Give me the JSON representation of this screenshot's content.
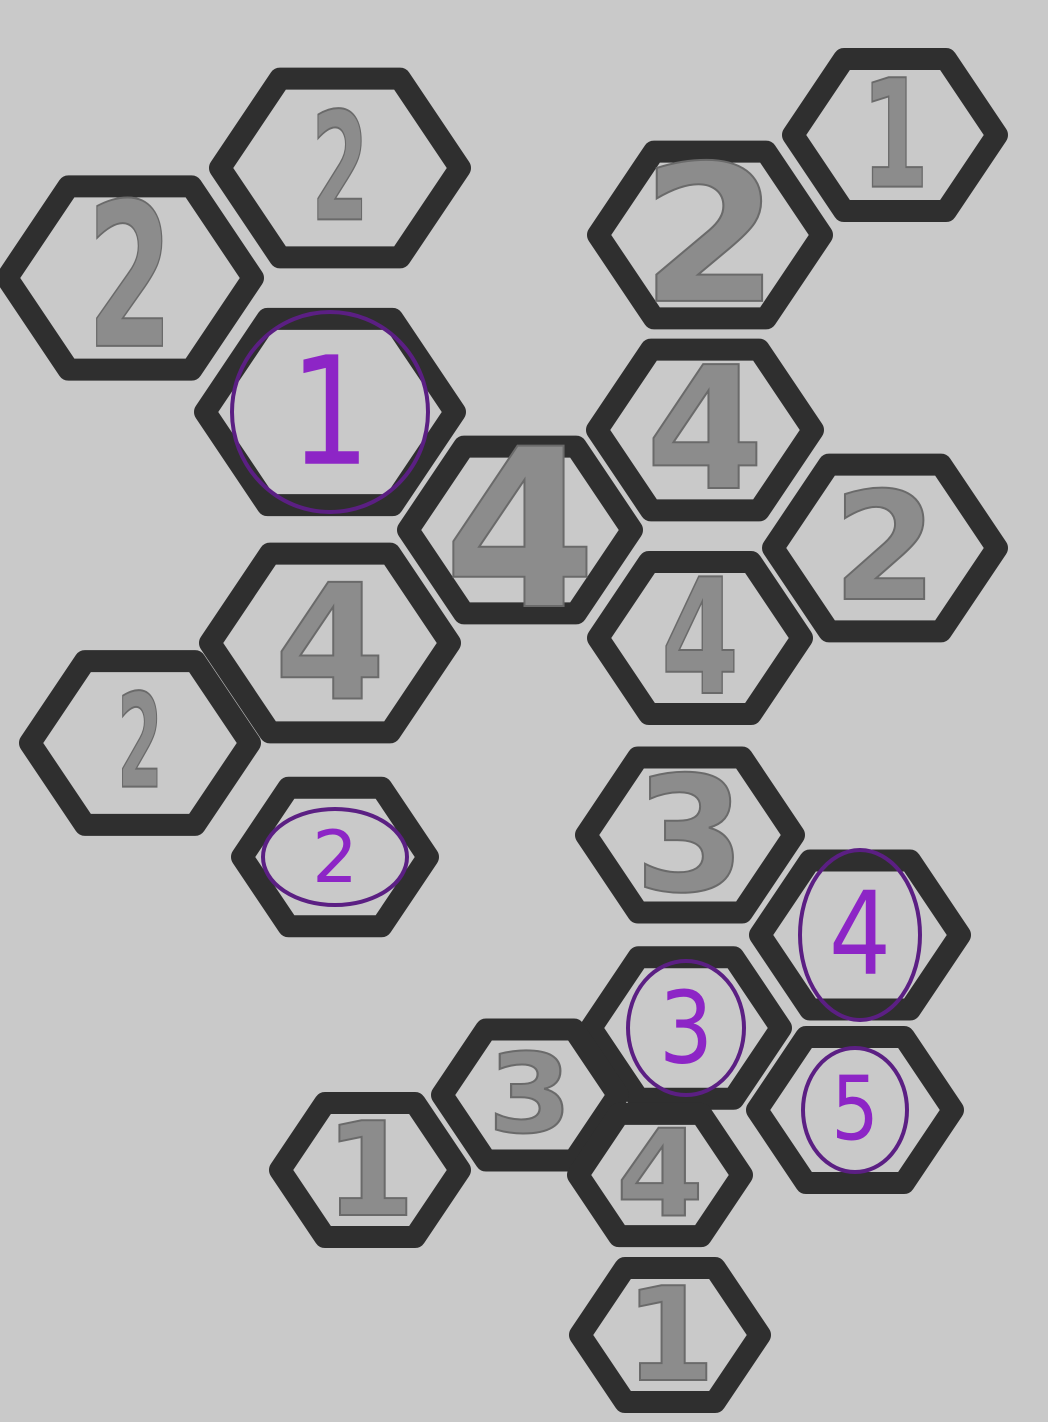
{
  "colors": {
    "background": "#c9c9c9",
    "hex_border": "#2f2f2f",
    "clue_fill": "#8c8c8c",
    "clue_outline": "#6a6a6a",
    "marked_text": "#8d25c6",
    "marked_ring": "#5b1f83"
  },
  "puzzle": {
    "cells": [
      {
        "value": "2",
        "marked": false
      },
      {
        "value": "2",
        "marked": false
      },
      {
        "value": "1",
        "marked": true
      },
      {
        "value": "4",
        "marked": false
      },
      {
        "value": "2",
        "marked": false
      },
      {
        "value": "2",
        "marked": true
      },
      {
        "value": "4",
        "marked": false
      },
      {
        "value": "1",
        "marked": false
      },
      {
        "value": "2",
        "marked": false
      },
      {
        "value": "4",
        "marked": false
      },
      {
        "value": "2",
        "marked": false
      },
      {
        "value": "4",
        "marked": false
      },
      {
        "value": "3",
        "marked": false
      },
      {
        "value": "4",
        "marked": true
      },
      {
        "value": "3",
        "marked": true
      },
      {
        "value": "5",
        "marked": true
      },
      {
        "value": "3",
        "marked": false
      },
      {
        "value": "1",
        "marked": false
      },
      {
        "value": "4",
        "marked": false
      },
      {
        "value": "1",
        "marked": false
      }
    ]
  }
}
